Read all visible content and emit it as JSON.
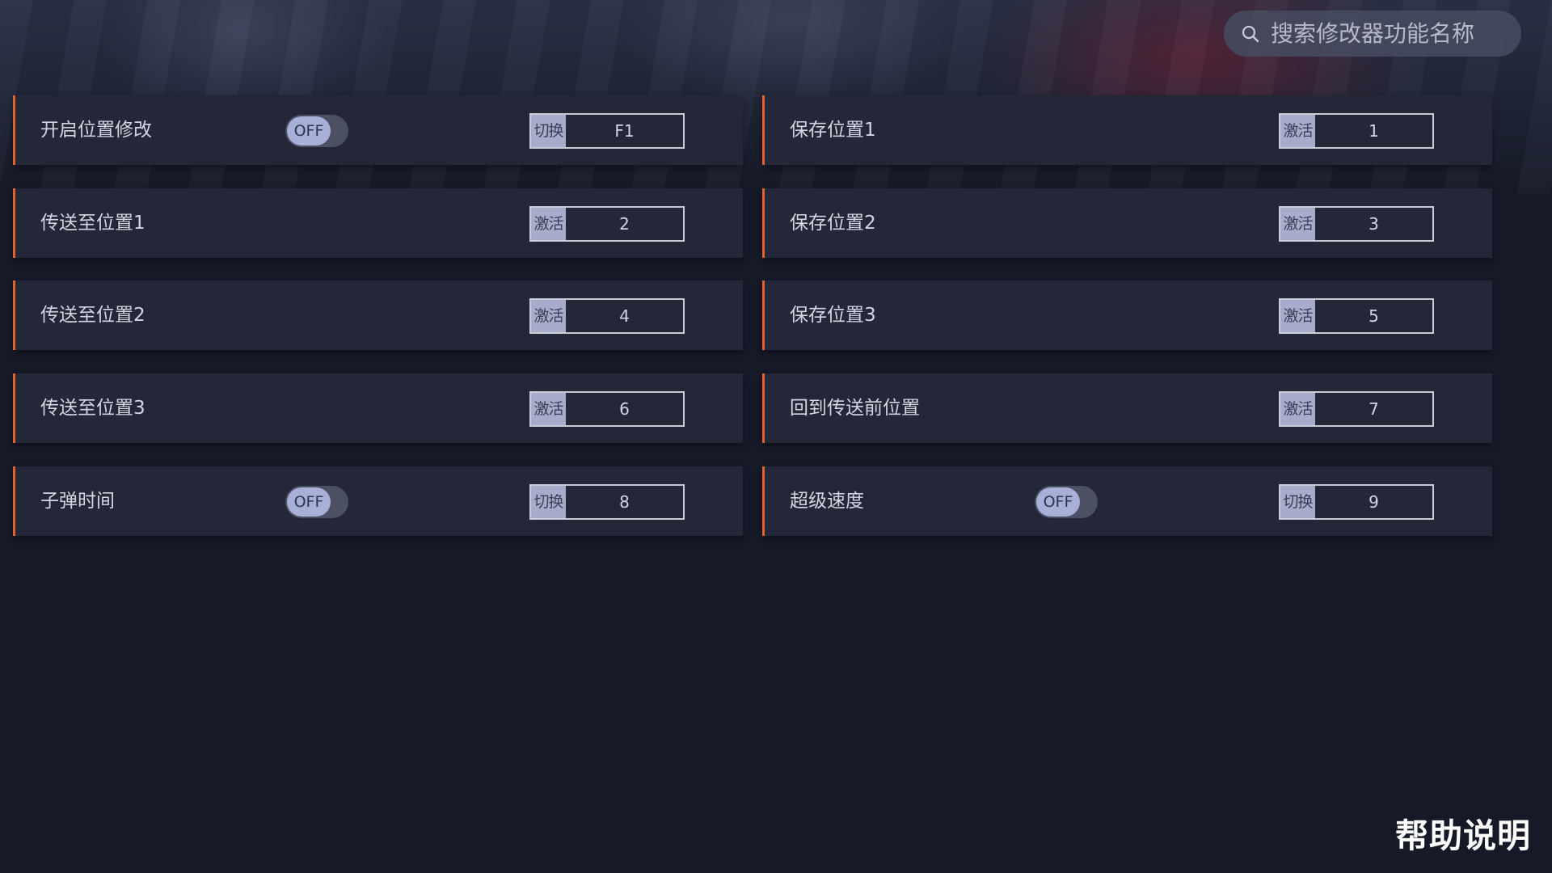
{
  "search": {
    "placeholder": "搜索修改器功能名称",
    "icon": "search-icon"
  },
  "left": [
    {
      "label": "开启位置修改",
      "toggle": "OFF",
      "type": "切换",
      "key": "F1"
    },
    {
      "label": "传送至位置1",
      "type": "激活",
      "key": "2"
    },
    {
      "label": "传送至位置2",
      "type": "激活",
      "key": "4"
    },
    {
      "label": "传送至位置3",
      "type": "激活",
      "key": "6"
    },
    {
      "label": "子弹时间",
      "toggle": "OFF",
      "type": "切换",
      "key": "8"
    }
  ],
  "right": [
    {
      "label": "保存位置1",
      "type": "激活",
      "key": "1"
    },
    {
      "label": "保存位置2",
      "type": "激活",
      "key": "3"
    },
    {
      "label": "保存位置3",
      "type": "激活",
      "key": "5"
    },
    {
      "label": "回到传送前位置",
      "type": "激活",
      "key": "7"
    },
    {
      "label": "超级速度",
      "toggle": "OFF",
      "type": "切换",
      "key": "9"
    }
  ],
  "help_label": "帮助说明",
  "colors": {
    "accent": "#e4622c",
    "row_bg": "#232738",
    "page_bg": "#161a28",
    "toggle_knob": "#a9b0d8"
  }
}
